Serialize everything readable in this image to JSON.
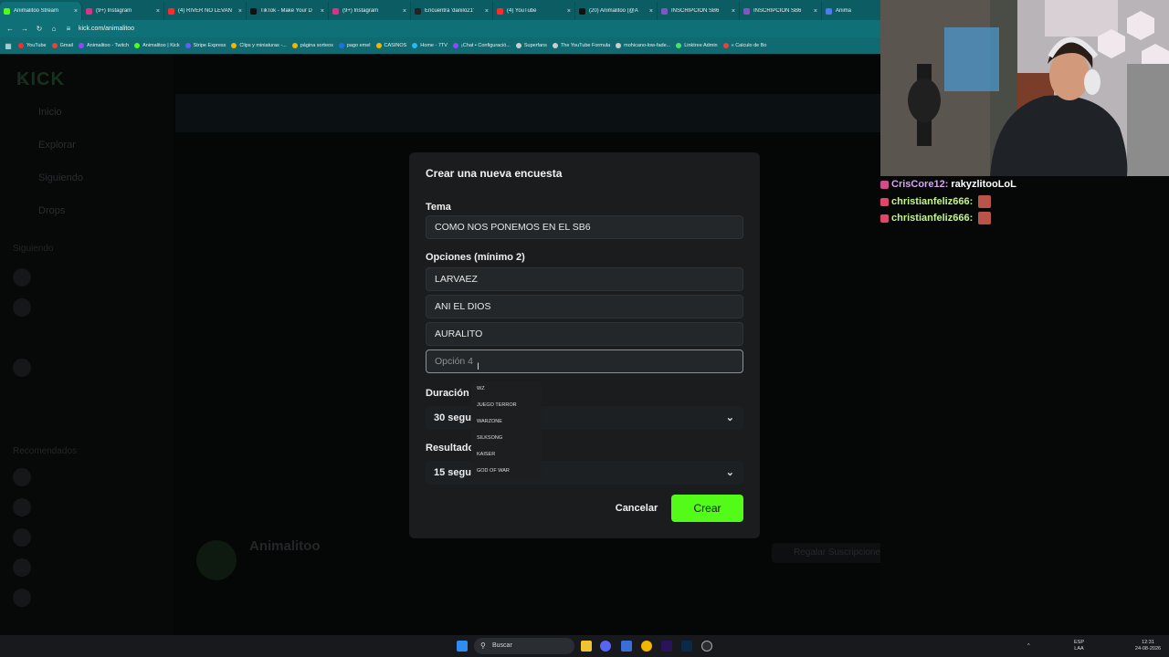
{
  "browser": {
    "tabs": [
      {
        "label": "Animalitoo Stream",
        "color": "#53fc18",
        "active": true
      },
      {
        "label": "(9+) Instagram",
        "color": "#d6338a"
      },
      {
        "label": "(4) RIVER NO LEVAN",
        "color": "#ff2a2a"
      },
      {
        "label": "TikTok - Make Your D",
        "color": "#111111"
      },
      {
        "label": "(9+) Instagram",
        "color": "#d6338a"
      },
      {
        "label": "Encuentra 'danilo21'",
        "color": "#222222"
      },
      {
        "label": "(4) YouTube",
        "color": "#ff2a2a"
      },
      {
        "label": "(20) Animalitoo (@A",
        "color": "#111111"
      },
      {
        "label": "INSCRIPCIÓN SB6",
        "color": "#7e57c2"
      },
      {
        "label": "INSCRIPCIÓN SB6",
        "color": "#7e57c2"
      },
      {
        "label": "Anima",
        "color": "#4c7cf0"
      }
    ],
    "url": "kick.com/animalitoo",
    "bookmarks": [
      {
        "label": "YouTube",
        "color": "#ff2a2a"
      },
      {
        "label": "Gmail",
        "color": "#ea4335"
      },
      {
        "label": "Animalitoo - Twitch",
        "color": "#9146ff"
      },
      {
        "label": "Animalitoo | Kick",
        "color": "#53fc18"
      },
      {
        "label": "Stripe Express",
        "color": "#635bff"
      },
      {
        "label": "Clips y miniaturas -...",
        "color": "#f5b400"
      },
      {
        "label": "página sorteos",
        "color": "#f5b400"
      },
      {
        "label": "pago emel",
        "color": "#1a73e8"
      },
      {
        "label": "CASINOS",
        "color": "#f5b400"
      },
      {
        "label": "Home - 7TV",
        "color": "#29b6f6"
      },
      {
        "label": "¡Chat • Configuració...",
        "color": "#9146ff"
      },
      {
        "label": "Superfans",
        "color": "#cccccc"
      },
      {
        "label": "The YouTube Formula",
        "color": "#cccccc"
      },
      {
        "label": "mohicano-low-fade...",
        "color": "#cccccc"
      },
      {
        "label": "Linktree Admin",
        "color": "#43e660"
      },
      {
        "label": "« Calculo de Bo",
        "color": "#ea4335"
      }
    ]
  },
  "background": {
    "logo": "KICK",
    "nav": [
      "Inicio",
      "Explorar",
      "Siguiendo",
      "Drops"
    ],
    "section_following": "Siguiendo",
    "section_recommended": "Recomendados",
    "channel_name": "Animalitoo",
    "follow_button": "Regalar Suscripciones"
  },
  "modal": {
    "title": "Crear una nueva encuesta",
    "topic_label": "Tema",
    "topic_value": "COMO NOS PONEMOS EN EL SB6",
    "options_label": "Opciones (mínimo 2)",
    "options": [
      "LARVAEZ",
      "ANI EL DIOS",
      "AURALITO"
    ],
    "option4_placeholder": "Opción 4",
    "duration_label": "Duración",
    "duration_value": "30 segu",
    "results_label": "Resultado",
    "results_value": "15 segu",
    "cancel_label": "Cancelar",
    "create_label": "Crear"
  },
  "autocomplete": [
    "WZ",
    "JUEGO TERROR",
    "WARZONE",
    "SILKSONG",
    "KAISER",
    "GOD OF WAR"
  ],
  "chat_overlay": [
    {
      "user": "CrisCore12:",
      "message": "rakyzlitooLoL",
      "user_color": "#d7a3f2"
    },
    {
      "user": "christianfeliz666:",
      "message": "",
      "user_color": "#c4f58b"
    },
    {
      "user": "christianfeliz666:",
      "message": "",
      "user_color": "#c4f58b"
    }
  ],
  "taskbar": {
    "search_placeholder": "Buscar",
    "lang_top": "ESP",
    "lang_bottom": "LAA",
    "time": "12:31",
    "date": "24-08-2026"
  },
  "colors": {
    "accent": "#53fc18",
    "browser_chrome": "#107077"
  }
}
